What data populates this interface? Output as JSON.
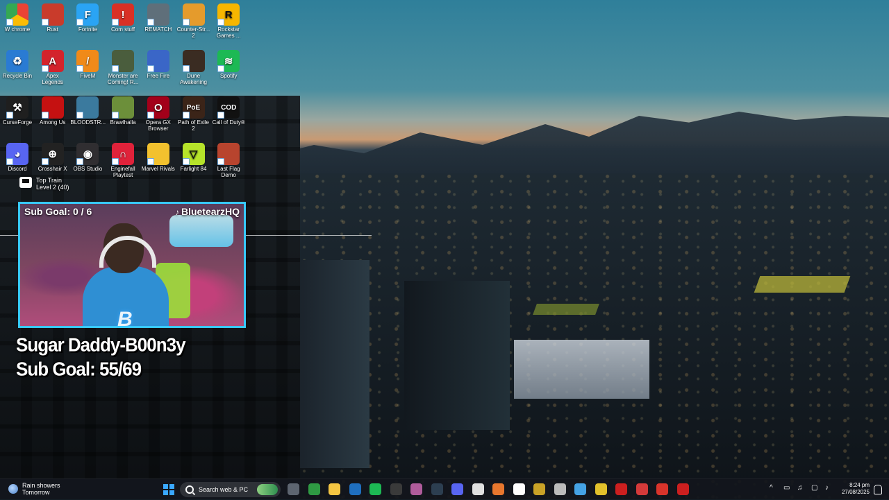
{
  "desktop": {
    "icons": [
      {
        "label": "W chrome",
        "glyph": "",
        "color": "#ffffff",
        "icon": "chrome-icon"
      },
      {
        "label": "Rust",
        "glyph": "",
        "color": "#c93b2b",
        "icon": "rust-icon"
      },
      {
        "label": "Fortnite",
        "glyph": "F",
        "color": "#2aa4f4",
        "icon": "fortnite-icon"
      },
      {
        "label": "Com stuff",
        "glyph": "!",
        "color": "#d93025",
        "icon": "com-stuff-icon"
      },
      {
        "label": "REMATCH",
        "glyph": "",
        "color": "#5f6f7a",
        "icon": "rematch-icon"
      },
      {
        "label": "Counter-Str... 2",
        "glyph": "",
        "color": "#e59b2c",
        "icon": "counter-strike-icon"
      },
      {
        "label": "Rockstar Games ...",
        "glyph": "R",
        "color": "#f6b600",
        "icon": "rockstar-icon"
      },
      {
        "label": "Recycle Bin",
        "glyph": "♻",
        "color": "#2a7bd3",
        "icon": "recycle-bin-icon"
      },
      {
        "label": "Apex Legends",
        "glyph": "A",
        "color": "#d3232c",
        "icon": "apex-legends-icon"
      },
      {
        "label": "FiveM",
        "glyph": "/",
        "color": "#f08a19",
        "icon": "fivem-icon"
      },
      {
        "label": "Monster are Coming! R...",
        "glyph": "",
        "color": "#4a5d3d",
        "icon": "monsters-icon"
      },
      {
        "label": "Free Fire",
        "glyph": "",
        "color": "#3a66c7",
        "icon": "free-fire-icon"
      },
      {
        "label": "Dune Awakening",
        "glyph": "",
        "color": "#3a2c22",
        "icon": "dune-icon"
      },
      {
        "label": "Spotify",
        "glyph": "≋",
        "color": "#1db954",
        "icon": "spotify-icon"
      },
      {
        "label": "CurseForge",
        "glyph": "⚒",
        "color": "#1f1f1f",
        "icon": "curseforge-icon"
      },
      {
        "label": "Among Us",
        "glyph": "",
        "color": "#c51111",
        "icon": "among-us-icon"
      },
      {
        "label": "BLOODSTR...",
        "glyph": "",
        "color": "#3b7a9e",
        "icon": "bloodstrike-icon"
      },
      {
        "label": "Brawlhalla",
        "glyph": "",
        "color": "#6c8f3a",
        "icon": "brawlhalla-icon"
      },
      {
        "label": "Opera GX Browser",
        "glyph": "O",
        "color": "#a3001a",
        "icon": "opera-gx-icon"
      },
      {
        "label": "Path of Exile 2",
        "glyph": "PoE",
        "color": "#3b2418",
        "icon": "path-of-exile-icon"
      },
      {
        "label": "Call of Duty®",
        "glyph": "COD",
        "color": "#111111",
        "icon": "call-of-duty-icon"
      },
      {
        "label": "Discord",
        "glyph": "◕",
        "color": "#5865f2",
        "icon": "discord-icon"
      },
      {
        "label": "Crosshair X",
        "glyph": "⊕",
        "color": "#222222",
        "icon": "crosshair-x-icon"
      },
      {
        "label": "OBS Studio",
        "glyph": "◉",
        "color": "#302e31",
        "icon": "obs-studio-icon"
      },
      {
        "label": "Enginefall Playtest",
        "glyph": "∩",
        "color": "#e0223a",
        "icon": "enginefall-icon"
      },
      {
        "label": "Marvel Rivals",
        "glyph": "",
        "color": "#f2c12e",
        "icon": "marvel-rivals-icon"
      },
      {
        "label": "Farlight 84",
        "glyph": "▽",
        "color": "#b6e32a",
        "icon": "farlight-icon"
      },
      {
        "label": "Last Flag Demo",
        "glyph": "",
        "color": "#b8442e",
        "icon": "last-flag-icon"
      }
    ]
  },
  "widget": {
    "title": "Top Train",
    "subtitle": "Level 2 (40)"
  },
  "webcam": {
    "sub_goal": "Sub Goal: 0 / 6",
    "username": "BluetearzHQ",
    "logo": "B"
  },
  "overlay": {
    "line1": "Sugar Daddy-B00n3y",
    "line2": "Sub Goal: 55/69"
  },
  "taskbar": {
    "weather_title": "Rain showers",
    "weather_sub": "Tomorrow",
    "search_placeholder": "Search web & PC",
    "apps": [
      "#5d6570",
      "#2f9a43",
      "#f4c542",
      "#1f6fbf",
      "#1db954",
      "#3a3a3a",
      "#b05c9b",
      "#2c3e50",
      "#5865f2",
      "#e0e0e0",
      "#e8772e",
      "#ffffff",
      "#c9a227",
      "#bbbbbb",
      "#45a3e5",
      "#e2c12b",
      "#cc1f1f",
      "#d43a3a",
      "#d9342b",
      "#cc1f1f"
    ],
    "tray_chevron": "^",
    "tray_icons": [
      "▭",
      "♫",
      "▢",
      "♪"
    ],
    "time": "8:24 pm",
    "date": "27/08/2025"
  }
}
